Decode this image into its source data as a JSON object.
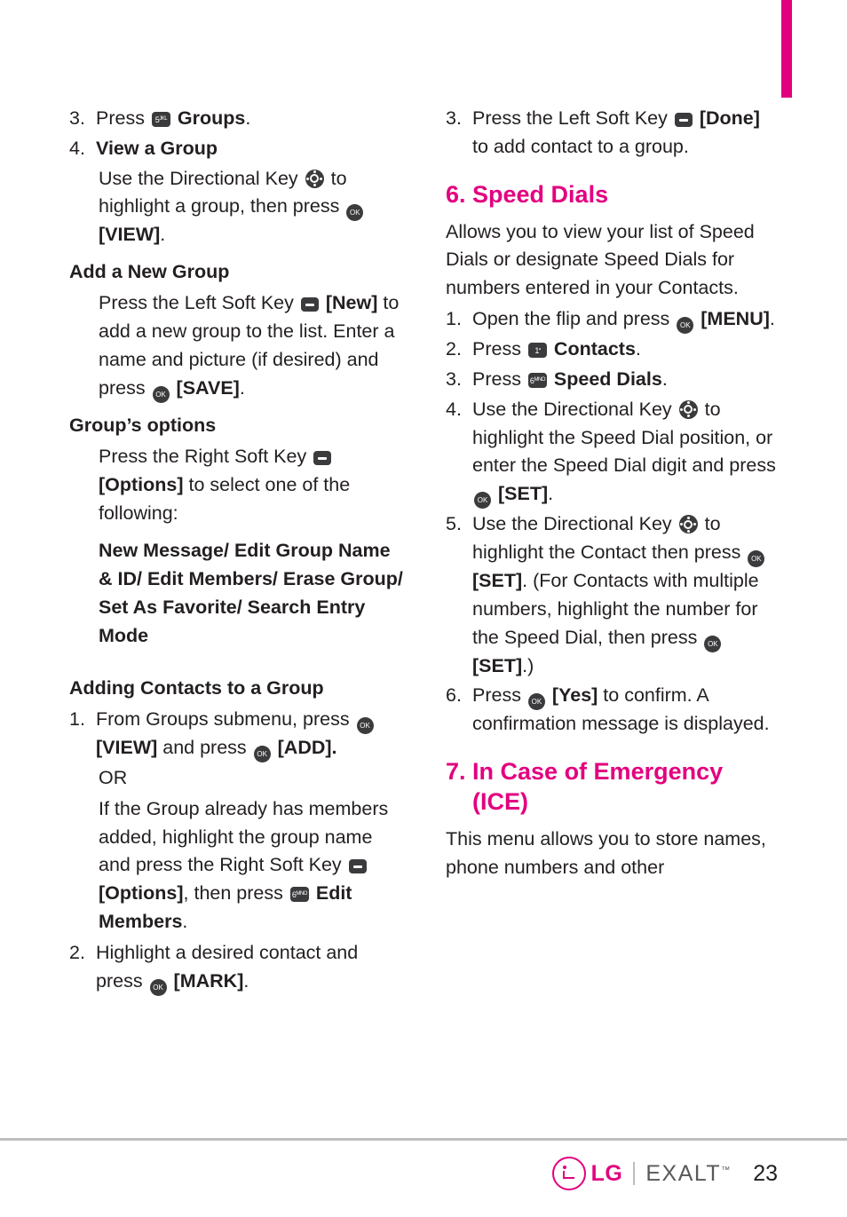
{
  "page": {
    "number": "23",
    "brand": "EXALT",
    "brand_tm": "™",
    "logo_text": "LG",
    "accent_color": "#e3007f",
    "text_color": "#231f20"
  },
  "left_column": {
    "items": [
      {
        "num": "3.",
        "parts": [
          {
            "t": "text",
            "v": "Press "
          },
          {
            "t": "key",
            "v": "key-5"
          },
          {
            "t": "bold",
            "v": " Groups"
          },
          {
            "t": "text",
            "v": "."
          }
        ]
      },
      {
        "num": "4.",
        "parts": [
          {
            "t": "bold",
            "v": "View a Group"
          }
        ]
      }
    ],
    "view_group_body": {
      "line1_a": "Use the Directional Key ",
      "line1_b": " to highlight a group, then press ",
      "line1_c": " ",
      "line1_d": "[VIEW]",
      "line1_e": "."
    },
    "add_new_group_heading": "Add a New Group",
    "add_new_group_body": {
      "a": "Press the Left Soft Key ",
      "b": " ",
      "c": "[New]",
      "d": " to add a new group to the list. Enter a name and picture (if desired) and press ",
      "e": " ",
      "f": "[SAVE]",
      "g": "."
    },
    "groups_options_heading": "Group’s options",
    "groups_options_body": {
      "a": "Press the Right Soft Key ",
      "b": " ",
      "c": "[Options]",
      "d": " to select one of the following:"
    },
    "options_list": "New Message/ Edit Group Name & ID/ Edit Members/ Erase Group/ Set As Favorite/ Search Entry Mode",
    "adding_contacts_heading": "Adding Contacts to a Group",
    "adding_contacts_items": [
      {
        "num": "1.",
        "a": "From Groups submenu, press ",
        "b": " ",
        "c": "[VIEW]",
        "d": " and press ",
        "e": " ",
        "f": "[ADD]",
        "g": "."
      }
    ],
    "or_label": "OR",
    "or_body": {
      "a": "If the Group already has members added, highlight the group name and press the Right Soft Key ",
      "b": " ",
      "c": "[Options]",
      "d": ", then press ",
      "e": " ",
      "f": "Edit Members",
      "g": "."
    },
    "item2": {
      "num": "2.",
      "a": "Highlight a desired contact and press ",
      "b": " ",
      "c": "[MARK]",
      "d": "."
    }
  },
  "right_column": {
    "item3": {
      "num": "3.",
      "a": "Press the Left Soft Key ",
      "b": " ",
      "c": "[Done]",
      "d": " to add contact to a group."
    },
    "speed_dials_heading": "6. Speed Dials",
    "speed_dials_intro": "Allows you to view your list of Speed Dials or designate Speed Dials for numbers entered in your Contacts.",
    "speed_dials_steps": [
      {
        "num": "1.",
        "a": "Open the flip and press ",
        "b": " ",
        "c": "[MENU]",
        "d": "."
      },
      {
        "num": "2.",
        "a": "Press ",
        "key": "key-1",
        "b": " ",
        "c": "Contacts",
        "d": "."
      },
      {
        "num": "3.",
        "a": "Press ",
        "key": "key-6",
        "b": " ",
        "c": "Speed Dials",
        "d": "."
      },
      {
        "num": "4.",
        "a": "Use the Directional Key ",
        "b": " to highlight the Speed Dial position, or enter the Speed Dial digit and press ",
        "c": " ",
        "d": "[SET]",
        "e": "."
      },
      {
        "num": "5.",
        "a": "Use the Directional Key ",
        "b": " to highlight the Contact then press ",
        "c": " ",
        "d": "[SET]",
        "e": ". (For Contacts with multiple numbers, highlight the number for the Speed Dial, then press ",
        "f": " ",
        "g": "[SET]",
        "h": ".)"
      },
      {
        "num": "6.",
        "a": "Press ",
        "b": " ",
        "c": "[Yes]",
        "d": " to confirm. A confirmation message is displayed."
      }
    ],
    "ice_heading_line1": "7. In Case of Emergency",
    "ice_heading_line2": "(ICE)",
    "ice_body": "This menu allows you to store names, phone numbers and other"
  },
  "icons": {
    "key_5": {
      "label": "5",
      "sup": "JKL"
    },
    "key_1": {
      "label": "1",
      "sup": "•"
    },
    "key_6": {
      "label": "6",
      "sup": "MNO"
    },
    "ok_key": "OK",
    "soft_key": "soft-key",
    "directional_key": "directional-key"
  }
}
